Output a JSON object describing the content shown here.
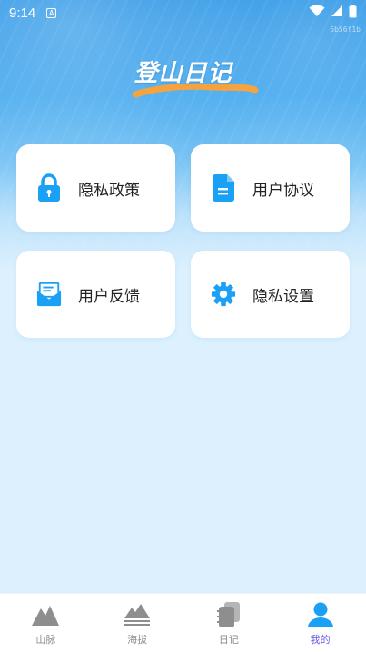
{
  "status_bar": {
    "time": "9:14",
    "notification_glyph": "A",
    "corner_id": "6b56f1b"
  },
  "app": {
    "title": "登山日记"
  },
  "cards": [
    {
      "label": "隐私政策",
      "icon": "lock-icon"
    },
    {
      "label": "用户协议",
      "icon": "document-icon"
    },
    {
      "label": "用户反馈",
      "icon": "mail-icon"
    },
    {
      "label": "隐私设置",
      "icon": "gear-icon"
    }
  ],
  "tabbar": {
    "tabs": [
      {
        "label": "山脉",
        "icon": "mountain-icon",
        "active": false
      },
      {
        "label": "海拔",
        "icon": "altitude-icon",
        "active": false
      },
      {
        "label": "日记",
        "icon": "notebook-icon",
        "active": false
      },
      {
        "label": "我的",
        "icon": "user-icon",
        "active": true
      }
    ]
  },
  "colors": {
    "accent": "#1aa0f5",
    "active_tab": "#6c5ce7",
    "inactive_tab": "#8e8e8e",
    "title_underline": "#f5a340"
  }
}
